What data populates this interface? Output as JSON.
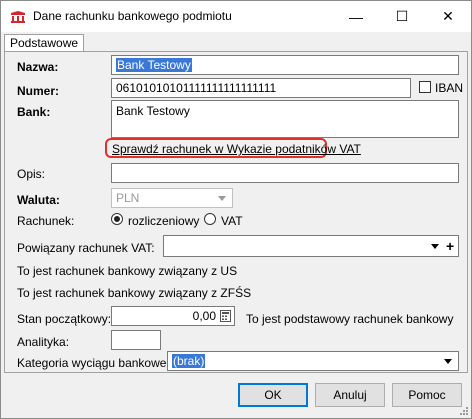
{
  "window": {
    "title": "Dane rachunku bankowego podmiotu",
    "minimize": "—",
    "maximize": "☐",
    "close": "✕"
  },
  "tabs": [
    {
      "label": "Podstawowe",
      "active": true
    }
  ],
  "form": {
    "nazwa_label": "Nazwa:",
    "nazwa_value": "Bank Testowy",
    "numer_label": "Numer:",
    "numer_value": "06101010101111111111111111",
    "iban_label": "IBAN",
    "iban_checked": false,
    "bank_label": "Bank:",
    "bank_value": "Bank Testowy",
    "verify_link": "Sprawdź rachunek w Wykazie podatników VAT",
    "opis_label": "Opis:",
    "opis_value": "",
    "waluta_label": "Waluta:",
    "waluta_value": "PLN",
    "rachunek_label": "Rachunek:",
    "rachunek_options": [
      "rozliczeniowy",
      "VAT"
    ],
    "rachunek_selected": "rozliczeniowy",
    "powiazany_label": "Powiązany rachunek VAT:",
    "powiazany_value": "",
    "plus_symbol": "+",
    "info_us": "To jest rachunek bankowy związany z US",
    "info_zfss": "To jest rachunek bankowy związany z ZFŚS",
    "stan_label": "Stan początkowy:",
    "stan_value": "0,00",
    "podstawowy_info": "To jest podstawowy rachunek bankowy",
    "analityka_label": "Analityka:",
    "analityka_value": "",
    "kategoria_label": "Kategoria wyciągu bankowego:",
    "kategoria_value": "(brak)"
  },
  "buttons": {
    "ok": "OK",
    "cancel": "Anuluj",
    "help": "Pomoc"
  },
  "colors": {
    "highlight": "#e0302a",
    "selection": "#3a78d8"
  }
}
